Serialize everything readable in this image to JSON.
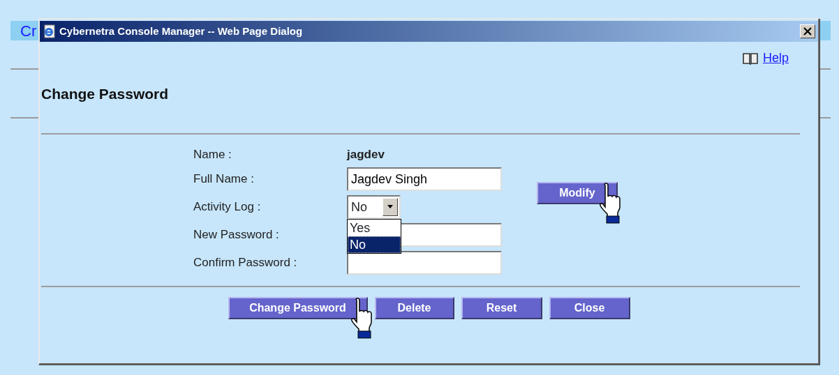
{
  "background": {
    "title": "Cr"
  },
  "window": {
    "title": "Cybernetra Console Manager -- Web Page Dialog"
  },
  "help": "Help",
  "heading": "Change Password",
  "fields": [
    {
      "kind": "text",
      "label": "Name :",
      "value": "jagdev"
    },
    {
      "kind": "input",
      "label": "Full Name :",
      "value": "Jagdev Singh"
    },
    {
      "kind": "select",
      "label": "Activity Log :",
      "value": "No",
      "expanded": true,
      "options": [
        {
          "label": "Yes",
          "selected": false
        },
        {
          "label": "No",
          "selected": true
        }
      ]
    },
    {
      "kind": "password",
      "label": "New Password :"
    },
    {
      "kind": "password",
      "label": "Confirm Password :"
    }
  ],
  "modify_button": {
    "label": "Modify",
    "hovered": true
  },
  "buttons": [
    {
      "label": "Change Password",
      "hovered": true
    },
    {
      "label": "Delete",
      "hovered": false
    },
    {
      "label": "Reset",
      "hovered": false
    },
    {
      "label": "Close",
      "hovered": false
    }
  ]
}
